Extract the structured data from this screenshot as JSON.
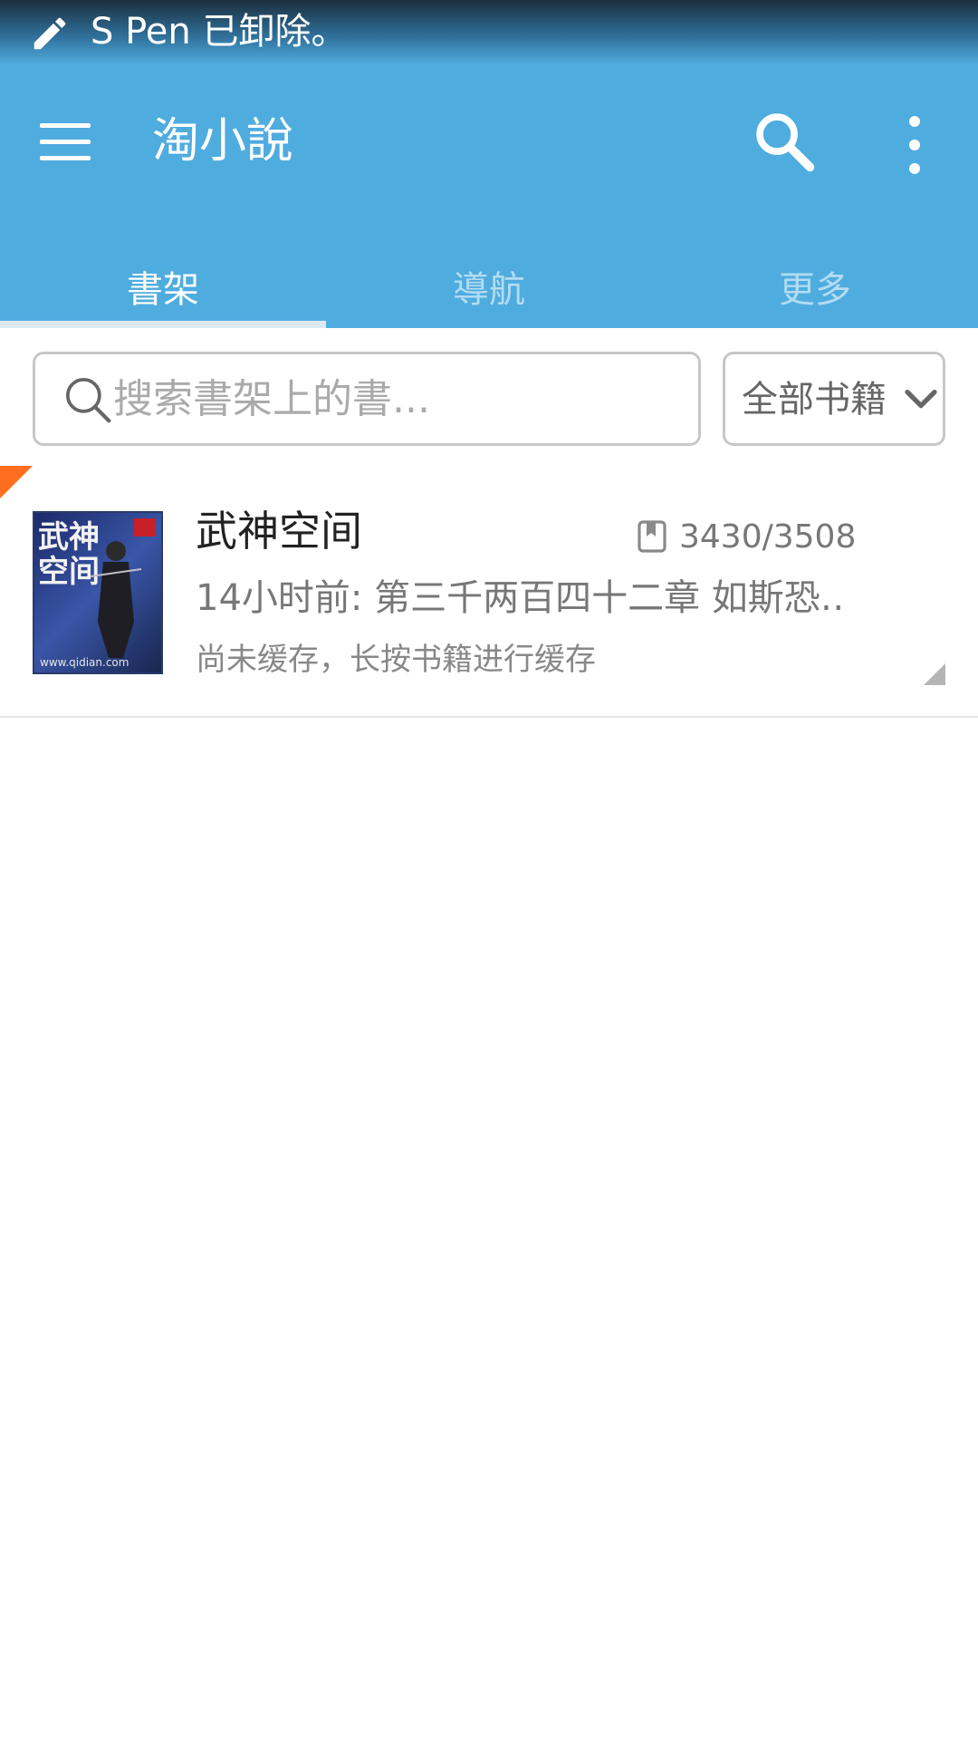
{
  "status_bar": {
    "message": "S Pen 已卸除。",
    "icon": "pen-icon"
  },
  "app_bar": {
    "title": "淘小說",
    "menu_icon": "hamburger-menu-icon",
    "search_icon": "search-icon",
    "overflow_icon": "more-vert-icon",
    "color": "#4facdf"
  },
  "tabs": [
    {
      "label": "書架",
      "active": true
    },
    {
      "label": "導航",
      "active": false
    },
    {
      "label": "更多",
      "active": false
    }
  ],
  "search": {
    "placeholder": "搜索書架上的書..."
  },
  "filter": {
    "selected": "全部书籍"
  },
  "books": [
    {
      "title": "武神空间",
      "progress": "3430/3508",
      "latest": "14小时前: 第三千两百四十二章 如斯恐…",
      "cache_status": "尚未缓存，长按书籍进行缓存",
      "cover": {
        "title": "武神空间",
        "url": "www.qidian.com"
      },
      "new_tag_color": "#ff6d1f"
    }
  ]
}
